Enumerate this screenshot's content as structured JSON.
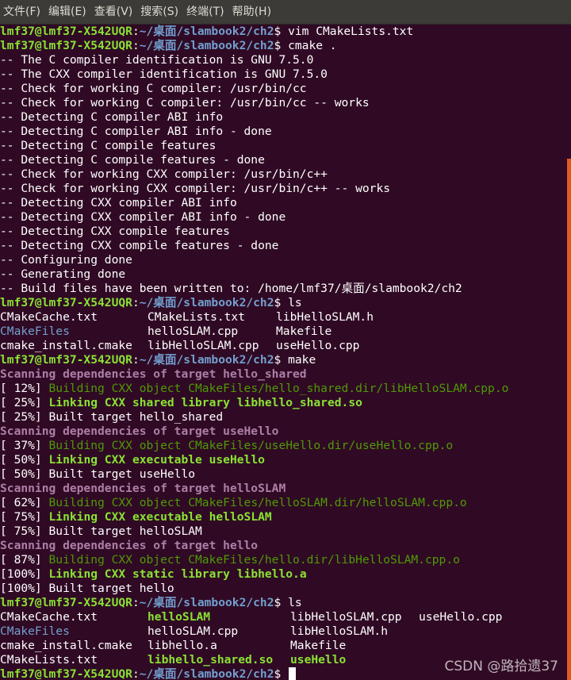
{
  "menubar": {
    "items": [
      "文件(F)",
      "编辑(E)",
      "查看(V)",
      "搜索(S)",
      "终端(T)",
      "帮助(H)"
    ]
  },
  "colors": {
    "background": "#300A24",
    "menubar": "#3c3b37",
    "user_green": "#8ae234",
    "path_blue": "#729fcf",
    "scanning_magenta": "#ad7fa8",
    "building_green": "#4e9a06",
    "scrollbar": "#e05a1e"
  },
  "prompt": {
    "user": "lmf37@lmf37-X542UQR",
    "sep": ":",
    "path": "~/桌面/slambook2/ch2",
    "symbol": "$ "
  },
  "lines": [
    {
      "kind": "prompt",
      "cmd": "vim CMakeLists.txt"
    },
    {
      "kind": "prompt",
      "cmd": "cmake ."
    },
    {
      "kind": "text",
      "text": "-- The C compiler identification is GNU 7.5.0"
    },
    {
      "kind": "text",
      "text": "-- The CXX compiler identification is GNU 7.5.0"
    },
    {
      "kind": "text",
      "text": "-- Check for working C compiler: /usr/bin/cc"
    },
    {
      "kind": "text",
      "text": "-- Check for working C compiler: /usr/bin/cc -- works"
    },
    {
      "kind": "text",
      "text": "-- Detecting C compiler ABI info"
    },
    {
      "kind": "text",
      "text": "-- Detecting C compiler ABI info - done"
    },
    {
      "kind": "text",
      "text": "-- Detecting C compile features"
    },
    {
      "kind": "text",
      "text": "-- Detecting C compile features - done"
    },
    {
      "kind": "text",
      "text": "-- Check for working CXX compiler: /usr/bin/c++"
    },
    {
      "kind": "text",
      "text": "-- Check for working CXX compiler: /usr/bin/c++ -- works"
    },
    {
      "kind": "text",
      "text": "-- Detecting CXX compiler ABI info"
    },
    {
      "kind": "text",
      "text": "-- Detecting CXX compiler ABI info - done"
    },
    {
      "kind": "text",
      "text": "-- Detecting CXX compile features"
    },
    {
      "kind": "text",
      "text": "-- Detecting CXX compile features - done"
    },
    {
      "kind": "text",
      "text": "-- Configuring done"
    },
    {
      "kind": "text",
      "text": "-- Generating done"
    },
    {
      "kind": "text",
      "text": "-- Build files have been written to: /home/lmf37/桌面/slambook2/ch2"
    },
    {
      "kind": "prompt",
      "cmd": "ls"
    },
    {
      "kind": "ls3",
      "cols": [
        {
          "text": "CMakeCache.txt",
          "style": "white"
        },
        {
          "text": "CMakeLists.txt",
          "style": "white"
        },
        {
          "text": "libHelloSLAM.h",
          "style": "white"
        }
      ]
    },
    {
      "kind": "ls3",
      "cols": [
        {
          "text": "CMakeFiles",
          "style": "dir"
        },
        {
          "text": "helloSLAM.cpp",
          "style": "white"
        },
        {
          "text": "Makefile",
          "style": "white"
        }
      ]
    },
    {
      "kind": "ls3",
      "cols": [
        {
          "text": "cmake_install.cmake",
          "style": "white"
        },
        {
          "text": "libHelloSLAM.cpp",
          "style": "white"
        },
        {
          "text": "useHello.cpp",
          "style": "white"
        }
      ]
    },
    {
      "kind": "prompt",
      "cmd": "make"
    },
    {
      "kind": "styled",
      "segs": [
        {
          "text": "Scanning dependencies of target hello_shared",
          "style": "magenta"
        }
      ]
    },
    {
      "kind": "styled",
      "segs": [
        {
          "text": "[ 12%] ",
          "style": "white"
        },
        {
          "text": "Building CXX object CMakeFiles/hello_shared.dir/libHelloSLAM.cpp.o",
          "style": "green"
        }
      ]
    },
    {
      "kind": "styled",
      "segs": [
        {
          "text": "[ 25%] ",
          "style": "white"
        },
        {
          "text": "Linking CXX shared library libhello_shared.so",
          "style": "lgreen"
        }
      ]
    },
    {
      "kind": "styled",
      "segs": [
        {
          "text": "[ 25%] Built target hello_shared",
          "style": "white"
        }
      ]
    },
    {
      "kind": "styled",
      "segs": [
        {
          "text": "Scanning dependencies of target useHello",
          "style": "magenta"
        }
      ]
    },
    {
      "kind": "styled",
      "segs": [
        {
          "text": "[ 37%] ",
          "style": "white"
        },
        {
          "text": "Building CXX object CMakeFiles/useHello.dir/useHello.cpp.o",
          "style": "green"
        }
      ]
    },
    {
      "kind": "styled",
      "segs": [
        {
          "text": "[ 50%] ",
          "style": "white"
        },
        {
          "text": "Linking CXX executable useHello",
          "style": "lgreen"
        }
      ]
    },
    {
      "kind": "styled",
      "segs": [
        {
          "text": "[ 50%] Built target useHello",
          "style": "white"
        }
      ]
    },
    {
      "kind": "styled",
      "segs": [
        {
          "text": "Scanning dependencies of target helloSLAM",
          "style": "magenta"
        }
      ]
    },
    {
      "kind": "styled",
      "segs": [
        {
          "text": "[ 62%] ",
          "style": "white"
        },
        {
          "text": "Building CXX object CMakeFiles/helloSLAM.dir/helloSLAM.cpp.o",
          "style": "green"
        }
      ]
    },
    {
      "kind": "styled",
      "segs": [
        {
          "text": "[ 75%] ",
          "style": "white"
        },
        {
          "text": "Linking CXX executable helloSLAM",
          "style": "lgreen"
        }
      ]
    },
    {
      "kind": "styled",
      "segs": [
        {
          "text": "[ 75%] Built target helloSLAM",
          "style": "white"
        }
      ]
    },
    {
      "kind": "styled",
      "segs": [
        {
          "text": "Scanning dependencies of target hello",
          "style": "magenta"
        }
      ]
    },
    {
      "kind": "styled",
      "segs": [
        {
          "text": "[ 87%] ",
          "style": "white"
        },
        {
          "text": "Building CXX object CMakeFiles/hello.dir/libHelloSLAM.cpp.o",
          "style": "green"
        }
      ]
    },
    {
      "kind": "styled",
      "segs": [
        {
          "text": "[100%] ",
          "style": "white"
        },
        {
          "text": "Linking CXX static library libhello.a",
          "style": "lgreen"
        }
      ]
    },
    {
      "kind": "styled",
      "segs": [
        {
          "text": "[100%] Built target hello",
          "style": "white"
        }
      ]
    },
    {
      "kind": "prompt",
      "cmd": "ls"
    },
    {
      "kind": "ls4",
      "cols": [
        {
          "text": "CMakeCache.txt",
          "style": "white"
        },
        {
          "text": "helloSLAM",
          "style": "lgreen"
        },
        {
          "text": "libHelloSLAM.cpp",
          "style": "white"
        },
        {
          "text": "useHello.cpp",
          "style": "white"
        }
      ]
    },
    {
      "kind": "ls4",
      "cols": [
        {
          "text": "CMakeFiles",
          "style": "dir"
        },
        {
          "text": "helloSLAM.cpp",
          "style": "white"
        },
        {
          "text": "libHelloSLAM.h",
          "style": "white"
        },
        {
          "text": "",
          "style": "white"
        }
      ]
    },
    {
      "kind": "ls4",
      "cols": [
        {
          "text": "cmake_install.cmake",
          "style": "white"
        },
        {
          "text": "libhello.a",
          "style": "white"
        },
        {
          "text": "Makefile",
          "style": "white"
        },
        {
          "text": "",
          "style": "white"
        }
      ]
    },
    {
      "kind": "ls4",
      "cols": [
        {
          "text": "CMakeLists.txt",
          "style": "white"
        },
        {
          "text": "libhello_shared.so",
          "style": "lgreen"
        },
        {
          "text": "useHello",
          "style": "lgreen"
        },
        {
          "text": "",
          "style": "white"
        }
      ]
    },
    {
      "kind": "prompt",
      "cmd": "",
      "cursor": true
    }
  ],
  "watermark": "CSDN @路拾遗37"
}
